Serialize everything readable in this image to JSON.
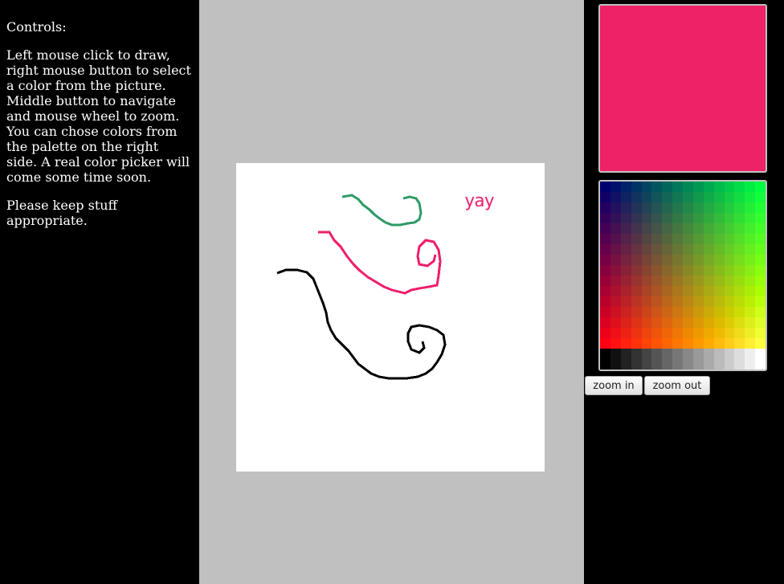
{
  "instructions": {
    "heading": "Controls:",
    "body": "Left mouse click to draw, right mouse button to select a color from the picture. Middle button to navigate and mouse wheel to zoom. You can chose colors from the palette on the right side. A real color picker will come some time soon.",
    "note": "Please keep stuff appropriate."
  },
  "canvas": {
    "drawn_text": "yay",
    "colors": {
      "background": "#ffffff",
      "green": "#2e9b66",
      "pink": "#ee1f6c",
      "black": "#000000"
    }
  },
  "selected_color": "#ee2266",
  "buttons": {
    "zoom_in": "zoom in",
    "zoom_out": "zoom out"
  },
  "icons": {
    "current-color-swatch": "color-preview",
    "palette": "color-palette-grid"
  }
}
